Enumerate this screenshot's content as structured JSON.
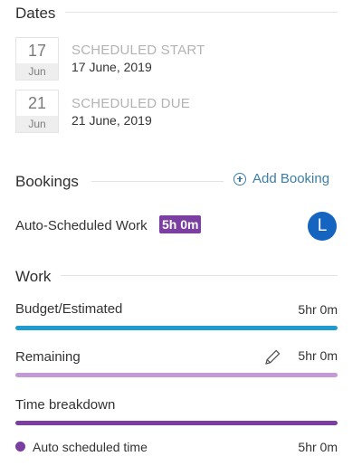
{
  "dates": {
    "title": "Dates",
    "start": {
      "day": "17",
      "month": "Jun",
      "caption": "SCHEDULED START",
      "value": "17 June, 2019"
    },
    "due": {
      "day": "21",
      "month": "Jun",
      "caption": "SCHEDULED DUE",
      "value": "21 June, 2019"
    }
  },
  "bookings": {
    "title": "Bookings",
    "add_label": "Add Booking",
    "item": {
      "label": "Auto-Scheduled Work",
      "badge": "5h 0m",
      "avatar_initial": "L"
    }
  },
  "work": {
    "title": "Work",
    "budget": {
      "label": "Budget/Estimated",
      "value": "5hr 0m",
      "color": "#1e9bd0",
      "fill": 1.0
    },
    "remaining": {
      "label": "Remaining",
      "value": "5hr 0m",
      "color": "#c39ad6",
      "fill": 1.0
    },
    "breakdown": {
      "label": "Time breakdown",
      "color": "#7a3fa1",
      "fill": 1.0,
      "legend": {
        "label": "Auto scheduled time",
        "value": "5hr 0m"
      }
    }
  },
  "colors": {
    "accent": "#3d7ea6",
    "badge": "#7a3fa1",
    "avatar": "#1565c0"
  }
}
